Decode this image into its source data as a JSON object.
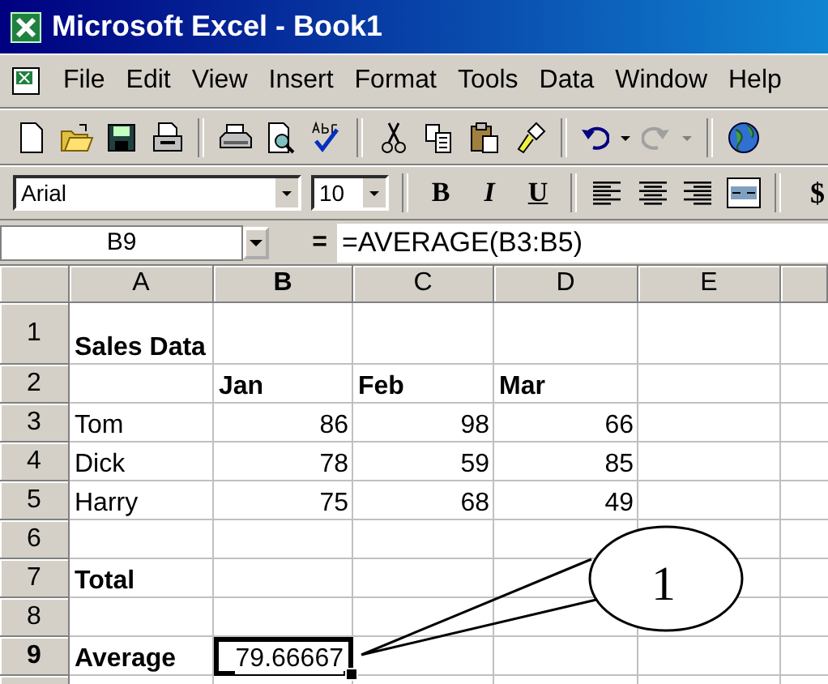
{
  "window": {
    "title": "Microsoft Excel - Book1"
  },
  "menu": [
    {
      "label": "File"
    },
    {
      "label": "Edit"
    },
    {
      "label": "View"
    },
    {
      "label": "Insert"
    },
    {
      "label": "Format"
    },
    {
      "label": "Tools"
    },
    {
      "label": "Data"
    },
    {
      "label": "Window"
    },
    {
      "label": "Help"
    }
  ],
  "format_bar": {
    "font": "Arial",
    "size": "10",
    "buttons": [
      {
        "label": "B",
        "kind": "bold"
      },
      {
        "label": "I",
        "kind": "italic"
      },
      {
        "label": "U",
        "kind": "underline"
      }
    ],
    "currency": "$"
  },
  "formula_bar": {
    "name_box": "B9",
    "equals": "=",
    "formula": "=AVERAGE(B3:B5)"
  },
  "sheet": {
    "columns": [
      {
        "label": "A",
        "selected": false
      },
      {
        "label": "B",
        "selected": true
      },
      {
        "label": "C",
        "selected": false
      },
      {
        "label": "D",
        "selected": false
      },
      {
        "label": "E",
        "selected": false
      }
    ],
    "rows": [
      {
        "number": "1",
        "selected": false,
        "cells": [
          {
            "text": "Sales Data",
            "bold": true,
            "kind": "text",
            "selected": false
          },
          null,
          null,
          null,
          null
        ]
      },
      {
        "number": "2",
        "selected": false,
        "cells": [
          null,
          {
            "text": "Jan",
            "bold": true,
            "kind": "text",
            "selected": false
          },
          {
            "text": "Feb",
            "bold": true,
            "kind": "text",
            "selected": false
          },
          {
            "text": "Mar",
            "bold": true,
            "kind": "text",
            "selected": false
          },
          null
        ]
      },
      {
        "number": "3",
        "selected": false,
        "cells": [
          {
            "text": "Tom",
            "bold": false,
            "kind": "text",
            "selected": false
          },
          {
            "text": "86",
            "bold": false,
            "kind": "number",
            "selected": false
          },
          {
            "text": "98",
            "bold": false,
            "kind": "number",
            "selected": false
          },
          {
            "text": "66",
            "bold": false,
            "kind": "number",
            "selected": false
          },
          null
        ]
      },
      {
        "number": "4",
        "selected": false,
        "cells": [
          {
            "text": "Dick",
            "bold": false,
            "kind": "text",
            "selected": false
          },
          {
            "text": "78",
            "bold": false,
            "kind": "number",
            "selected": false
          },
          {
            "text": "59",
            "bold": false,
            "kind": "number",
            "selected": false
          },
          {
            "text": "85",
            "bold": false,
            "kind": "number",
            "selected": false
          },
          null
        ]
      },
      {
        "number": "5",
        "selected": false,
        "cells": [
          {
            "text": "Harry",
            "bold": false,
            "kind": "text",
            "selected": false
          },
          {
            "text": "75",
            "bold": false,
            "kind": "number",
            "selected": false
          },
          {
            "text": "68",
            "bold": false,
            "kind": "number",
            "selected": false
          },
          {
            "text": "49",
            "bold": false,
            "kind": "number",
            "selected": false
          },
          null
        ]
      },
      {
        "number": "6",
        "selected": false,
        "cells": [
          null,
          null,
          null,
          null,
          null
        ]
      },
      {
        "number": "7",
        "selected": false,
        "cells": [
          {
            "text": "Total",
            "bold": true,
            "kind": "text",
            "selected": false
          },
          null,
          null,
          null,
          null
        ]
      },
      {
        "number": "8",
        "selected": false,
        "cells": [
          null,
          null,
          null,
          null,
          null
        ]
      },
      {
        "number": "9",
        "selected": true,
        "cells": [
          {
            "text": "Average",
            "bold": true,
            "kind": "text",
            "selected": false
          },
          {
            "text": "79.66667",
            "bold": false,
            "kind": "number",
            "selected": true
          },
          null,
          null,
          null
        ]
      }
    ]
  },
  "callout": {
    "label": "1"
  }
}
